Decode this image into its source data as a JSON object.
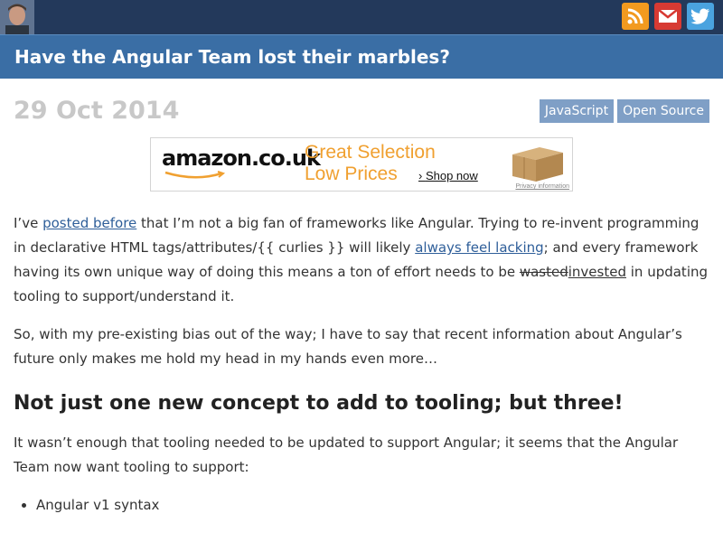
{
  "header": {
    "avatar_icon": "author-avatar",
    "social": [
      {
        "name": "rss-icon",
        "color": "#f29a1f"
      },
      {
        "name": "email-icon",
        "color": "#d73a33"
      },
      {
        "name": "twitter-icon",
        "color": "#4aa3df"
      }
    ]
  },
  "banner": {
    "title": "Have the Angular Team lost their marbles?"
  },
  "post": {
    "date": "29 Oct 2014",
    "tags": [
      "JavaScript",
      "Open Source"
    ]
  },
  "ad": {
    "logo": "amazon.co.uk",
    "line1": "Great Selection",
    "line2": "Low Prices",
    "cta": "Shop now",
    "privacy": "Privacy information"
  },
  "body": {
    "p1": {
      "t1": "I’ve ",
      "link1": "posted before",
      "t2": " that I’m not a big fan of frameworks like Angular. Trying to re-invent programming in declarative HTML tags/attributes/{{ curlies }} will likely ",
      "link2": "always feel lacking",
      "t3": "; and every framework having its own unique way of doing this means a ton of effort needs to be ",
      "struck": "wasted",
      "under": "invested",
      "t4": " in updating tooling to support/understand it."
    },
    "p2": "So, with my pre-existing bias out of the way; I have to say that recent information about Angular’s future only makes me hold my head in my hands even more…",
    "h2": "Not just one new concept to add to tooling; but three!",
    "p3": "It wasn’t enough that tooling needed to be updated to support Angular; it seems that the Angular Team now want tooling to support:",
    "list": [
      "Angular v1 syntax"
    ]
  }
}
